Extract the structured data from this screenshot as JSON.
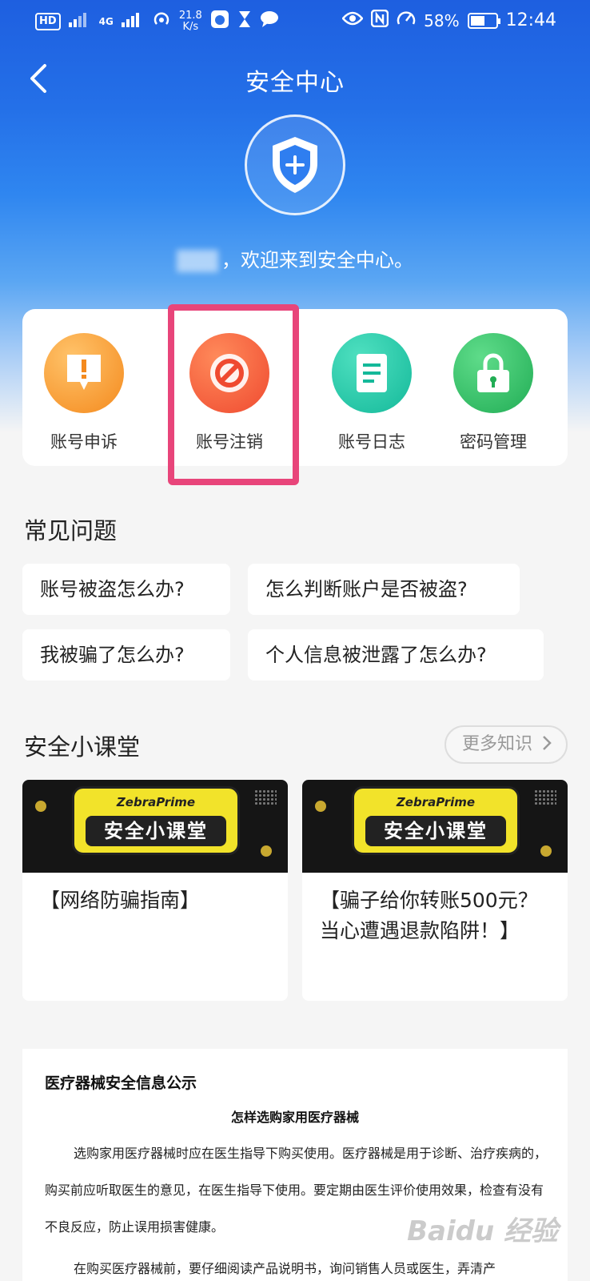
{
  "status_bar": {
    "left_tags": [
      "HD",
      "4G"
    ],
    "net_speed": "21.8",
    "net_speed_unit": "K/s",
    "battery": "58%",
    "battery_level": 0.58,
    "time": "12:44"
  },
  "nav": {
    "title": "安全中心"
  },
  "hero": {
    "welcome": "，欢迎来到安全中心。"
  },
  "quick_actions": [
    {
      "label": "账号申诉",
      "icon": "exclamation-icon",
      "color": "#f59a2a"
    },
    {
      "label": "账号注销",
      "icon": "prohibited-icon",
      "color": "#f0543a"
    },
    {
      "label": "账号日志",
      "icon": "document-icon",
      "color": "#20c7a8"
    },
    {
      "label": "密码管理",
      "icon": "lock-icon",
      "color": "#2fbd64"
    }
  ],
  "faq": {
    "title": "常见问题",
    "items": [
      "账号被盗怎么办?",
      "怎么判断账户是否被盗?",
      "我被骗了怎么办?",
      "个人信息被泄露了怎么办?"
    ]
  },
  "classroom": {
    "title": "安全小课堂",
    "more_label": "更多知识",
    "banner_brand": "ZebraPrime",
    "banner_title": "安全小课堂",
    "cards": [
      {
        "title": "【网络防骗指南】"
      },
      {
        "title": "【骗子给你转账500元？当心遭遇退款陷阱！】"
      }
    ]
  },
  "notice": {
    "heading": "医疗器械安全信息公示",
    "subheading": "怎样选购家用医疗器械",
    "paragraph1": "选购家用医疗器械时应在医生指导下购买使用。医疗器械是用于诊断、治疗疾病的，购买前应听取医生的意见，在医生指导下使用。要定期由医生评价使用效果，检查有没有不良反应，防止误用损害健康。",
    "paragraph2": "在购买医疗器械前，要仔细阅读产品说明书，询问销售人员或医生，弄清产"
  },
  "watermark": "Baidu 经验",
  "colors": {
    "highlight": "#e8457a",
    "hero_blue": "#1e5fe0"
  }
}
